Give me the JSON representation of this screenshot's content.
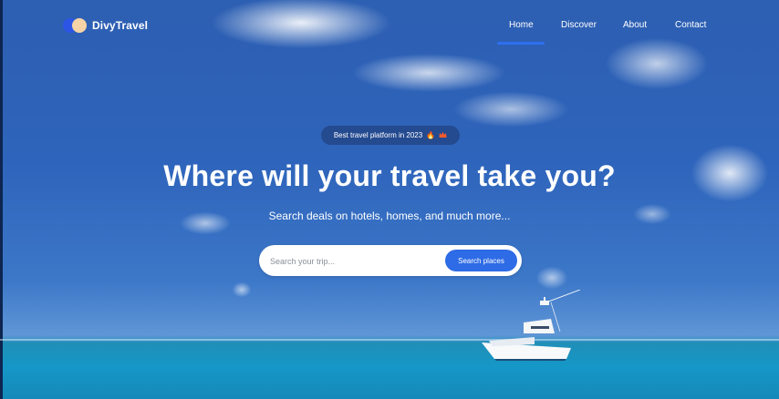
{
  "brand": {
    "name": "DivyTravel"
  },
  "nav": {
    "items": [
      {
        "label": "Home",
        "active": true
      },
      {
        "label": "Discover"
      },
      {
        "label": "About"
      },
      {
        "label": "Contact"
      }
    ]
  },
  "hero": {
    "badge": {
      "text": "Best travel platform in 2023",
      "icons": [
        "fire-icon",
        "crown-icon"
      ]
    },
    "title": "Where will your travel take you?",
    "subtitle": "Search deals on hotels, homes, and much more...",
    "search": {
      "placeholder": "Search your trip...",
      "button_label": "Search places"
    }
  },
  "colors": {
    "accent": "#2e6be6",
    "logo_primary": "#2c55e6",
    "logo_secondary": "#f6d3a6"
  }
}
